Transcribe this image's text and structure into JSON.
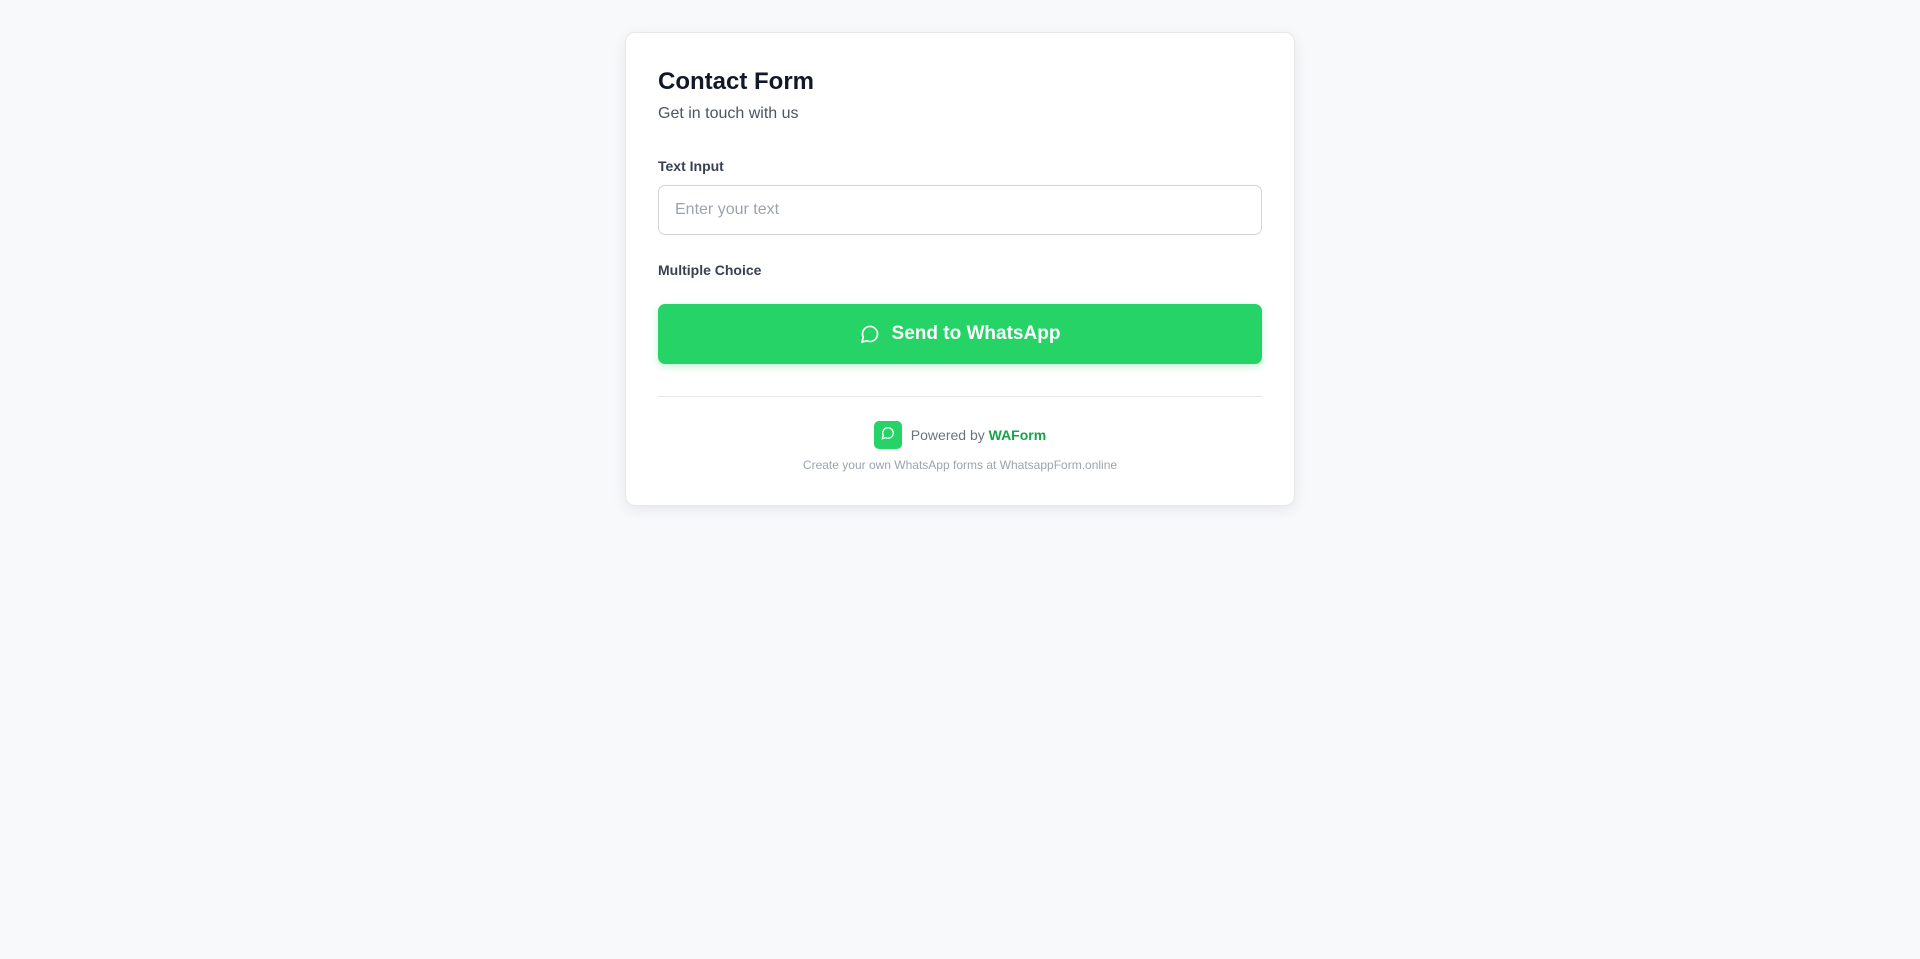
{
  "form": {
    "title": "Contact Form",
    "subtitle": "Get in touch with us",
    "fields": {
      "text_input": {
        "label": "Text Input",
        "placeholder": "Enter your text",
        "value": ""
      },
      "multiple_choice": {
        "label": "Multiple Choice"
      }
    },
    "submit": {
      "label": "Send to WhatsApp",
      "icon": "chat-bubble-icon",
      "color": "#25d366"
    }
  },
  "footer": {
    "powered_prefix": "Powered by",
    "brand_name": "WAForm",
    "brand_icon": "chat-bubble-icon",
    "brand_color": "#16a34a",
    "note": "Create your own WhatsApp forms at WhatsappForm.online"
  }
}
